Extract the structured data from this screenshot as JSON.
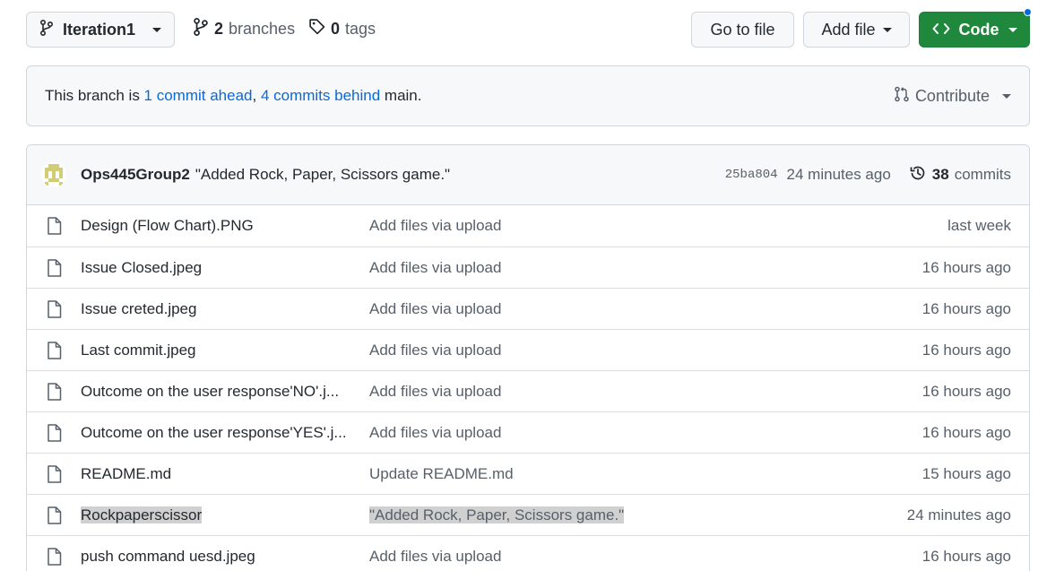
{
  "toolbar": {
    "branch_name": "Iteration1",
    "branches_count": "2",
    "branches_label": "branches",
    "tags_count": "0",
    "tags_label": "tags",
    "goto_file": "Go to file",
    "add_file": "Add file",
    "code": "Code"
  },
  "branch_info": {
    "prefix": "This branch is ",
    "ahead": "1 commit ahead",
    "separator": ", ",
    "behind": "4 commits behind",
    "suffix": " main.",
    "contribute": "Contribute"
  },
  "latest_commit": {
    "author": "Ops445Group2",
    "message": "\"Added Rock, Paper, Scissors game.\"",
    "sha": "25ba804",
    "age": "24 minutes ago",
    "commits_count": "38",
    "commits_label": "commits"
  },
  "files": [
    {
      "name": "Design (Flow Chart).PNG",
      "message": "Add files via upload",
      "age": "last week"
    },
    {
      "name": "Issue Closed.jpeg",
      "message": "Add files via upload",
      "age": "16 hours ago"
    },
    {
      "name": "Issue creted.jpeg",
      "message": "Add files via upload",
      "age": "16 hours ago"
    },
    {
      "name": "Last commit.jpeg",
      "message": "Add files via upload",
      "age": "16 hours ago"
    },
    {
      "name": "Outcome on the user response'NO'.j...",
      "message": "Add files via upload",
      "age": "16 hours ago"
    },
    {
      "name": "Outcome on the user response'YES'.j...",
      "message": "Add files via upload",
      "age": "16 hours ago"
    },
    {
      "name": "README.md",
      "message": "Update README.md",
      "age": "15 hours ago"
    },
    {
      "name": "Rockpaperscissor",
      "message": "\"Added Rock, Paper, Scissors game.\"",
      "age": "24 minutes ago"
    },
    {
      "name": "push command uesd.jpeg",
      "message": "Add files via upload",
      "age": "16 hours ago"
    }
  ],
  "colors": {
    "accent_link": "#0969da",
    "code_button": "#1f883d",
    "highlight": "#d0d0d0"
  }
}
